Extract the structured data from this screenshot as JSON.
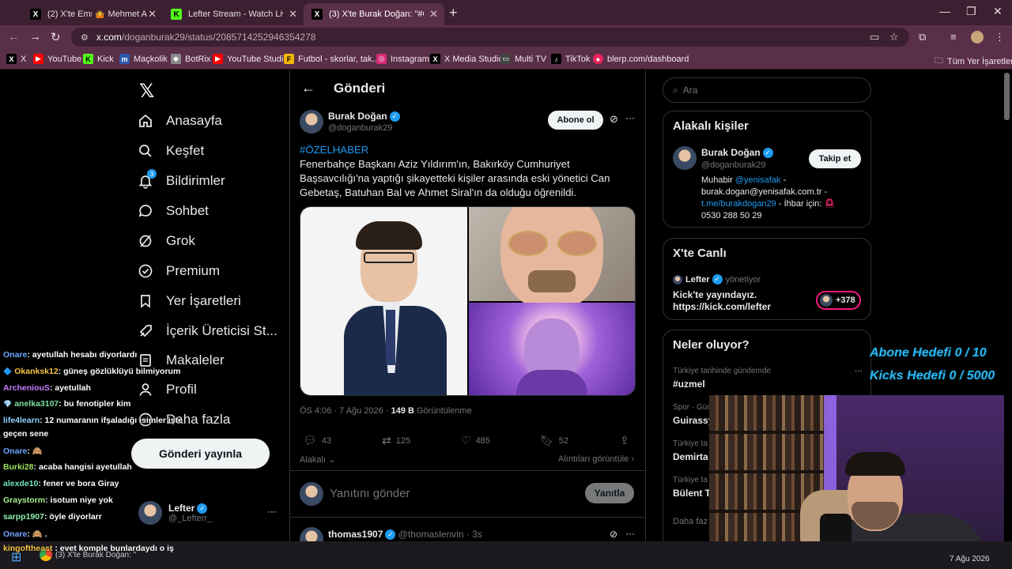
{
  "browser": {
    "tabs": [
      {
        "title": "(2) X'te Emre: \"",
        "title2": "Mehmet Arı",
        "icon": "x-logo-icon"
      },
      {
        "title": "Lefter Stream - Watch Live on K",
        "icon": "kick-icon"
      },
      {
        "title": "(3) X'te Burak Doğan: \"#ÖZELH",
        "icon": "x-logo-icon"
      }
    ],
    "new_tab": "+",
    "url_host": "x.com",
    "url_path": "/doganburak29/status/2085714252946354278",
    "bookmarks": [
      {
        "label": "X",
        "color": "#000000",
        "glyph": "X"
      },
      {
        "label": "YouTube",
        "color": "#ff0000",
        "glyph": "▶"
      },
      {
        "label": "Kick",
        "color": "#53fc18",
        "glyph": "K"
      },
      {
        "label": "Maçkolik",
        "color": "#2e5aac",
        "glyph": "m"
      },
      {
        "label": "BotRix",
        "color": "#8a8a8a",
        "glyph": "◆"
      },
      {
        "label": "YouTube Studio",
        "color": "#ff0000",
        "glyph": "▶"
      },
      {
        "label": "Futbol - skorlar, tak...",
        "color": "#f2b705",
        "glyph": "F"
      },
      {
        "label": "Instagram",
        "color": "#d62976",
        "glyph": "◎"
      },
      {
        "label": "X Media Studio",
        "color": "#000000",
        "glyph": "X"
      },
      {
        "label": "Multi TV",
        "color": "#444444",
        "glyph": "▭"
      },
      {
        "label": "TikTok",
        "color": "#000000",
        "glyph": "♪"
      },
      {
        "label": "blerp.com/dashboard",
        "color": "#e8255b",
        "glyph": "●"
      }
    ],
    "all_bookmarks": "Tüm Yer İşaretleri"
  },
  "sidebar": {
    "items": [
      {
        "label": "Anasayfa",
        "icon": "home-icon"
      },
      {
        "label": "Keşfet",
        "icon": "search-icon"
      },
      {
        "label": "Bildirimler",
        "icon": "bell-icon",
        "badge": "3"
      },
      {
        "label": "Sohbet",
        "icon": "chat-icon"
      },
      {
        "label": "Grok",
        "icon": "grok-icon"
      },
      {
        "label": "Premium",
        "icon": "premium-icon"
      },
      {
        "label": "Yer İşaretleri",
        "icon": "bookmark-icon"
      },
      {
        "label": "İçerik Üreticisi St...",
        "icon": "rocket-icon"
      },
      {
        "label": "Makaleler",
        "icon": "article-icon"
      },
      {
        "label": "Profil",
        "icon": "person-icon"
      },
      {
        "label": "Daha fazla",
        "icon": "more-icon"
      }
    ],
    "post_button": "Gönderi yayınla",
    "account": {
      "name": "Lefter",
      "handle": "@_Lefterr_",
      "more": "···"
    }
  },
  "main": {
    "header_title": "Gönderi",
    "author": {
      "name": "Burak Doğan",
      "handle": "@doganburak29"
    },
    "subscribe": "Abone ol",
    "hashtag": "#ÖZELHABER",
    "text": "Fenerbahçe Başkanı Aziz Yıldırım'ın, Bakırköy Cumhuriyet Başsavcılığı'na yaptığı şikayetteki kişiler arasında eski yönetici Can Gebetaş, Batuhan Bal ve Ahmet Siral'ın da olduğu öğrenildi.",
    "time": "ÖS 4:06 · 7 Ağu 2026 · ",
    "views_count": "149 B",
    "views_label": " Görüntülenme",
    "stats": {
      "replies": "43",
      "reposts": "125",
      "likes": "485",
      "bookmarks": "52"
    },
    "related": "Alakalı",
    "quotes": "Alıntıları görüntüle",
    "reply_placeholder": "Yanıtını gönder",
    "reply_button": "Yanıtla",
    "next_reply": {
      "name": "thomas1907",
      "handle": "@thomaslenvin · 3s"
    }
  },
  "right": {
    "search_placeholder": "Ara",
    "relevant": {
      "title": "Alakalı kişiler",
      "name": "Burak Doğan",
      "handle": "@doganburak29",
      "follow": "Takip et",
      "bio_1a": "Muhabir ",
      "bio_1b": "@yenisafak",
      "bio_1c": " -",
      "bio_2": "burak.dogan@yenisafak.com.tr -",
      "bio_3a": "t.me/burakdogan29",
      "bio_3b": " - İhbar için: ",
      "bio_4": "0530 288 50 29"
    },
    "live": {
      "title": "X'te Canlı",
      "name": "Lefter",
      "role": "yönetiyor",
      "line1": "Kick'te yayındayız.",
      "line2": "https://kick.com/lefter",
      "count": "+378"
    },
    "trends": {
      "title": "Neler oluyor?",
      "items": [
        {
          "context": "Türkiye tarihinde gündemde",
          "name": "#uzmel"
        },
        {
          "context": "Spor · Gün",
          "name": "Guirassy"
        },
        {
          "context": "Türkiye ta",
          "name": "Demirta"
        },
        {
          "context": "Türkiye ta",
          "name": "Bülent T"
        }
      ],
      "more": "Daha faz"
    }
  },
  "stream": {
    "goal_1": "Abone Hedefi 0 / 10",
    "goal_2": "Kicks Hedefi 0 / 5000",
    "chat": [
      {
        "user": "Onare",
        "color": "#6ea8ff",
        "msg": ": ayetullah hesabı diyorlardı"
      },
      {
        "user": "Okanksk12",
        "color": "#f5c542",
        "msg": ": güneş gözlüklüyü bilmiyorum"
      },
      {
        "user": "ArcheniouS",
        "color": "#c77dff",
        "msg": ": ayetullah"
      },
      {
        "user": "anelka3107",
        "color": "#7fe0a0",
        "msg": ": bu fenotipler kim"
      },
      {
        "user": "life4learn",
        "color": "#8fd3ff",
        "msg": ": 12 numaranın ifşaladığı isimler işte"
      },
      {
        "user": "",
        "color": "#ffffff",
        "msg": "geçen sene"
      },
      {
        "user": "Onare",
        "color": "#6ea8ff",
        "msg": ": 🙈"
      },
      {
        "user": "Burki28",
        "color": "#9be15d",
        "msg": ": acaba hangisi ayetullah"
      },
      {
        "user": "alexde10",
        "color": "#6fe3c1",
        "msg": ": fener ve bora Giray"
      },
      {
        "user": "Graystorm",
        "color": "#a6f08a",
        "msg": ": isotum niye yok"
      },
      {
        "user": "sarpp1907",
        "color": "#8ef0b0",
        "msg": ": öyle diyorlarr"
      },
      {
        "user": "Onare",
        "color": "#6ea8ff",
        "msg": ": 🙈 ."
      }
    ],
    "last_chat_user": "kingoftheast",
    "last_chat_msg": " : evet komple bunlardaydı o iş"
  },
  "taskbar": {
    "tip": "(3) X'te Burak Doğan: \"",
    "date": "7 Ağu 2026"
  }
}
